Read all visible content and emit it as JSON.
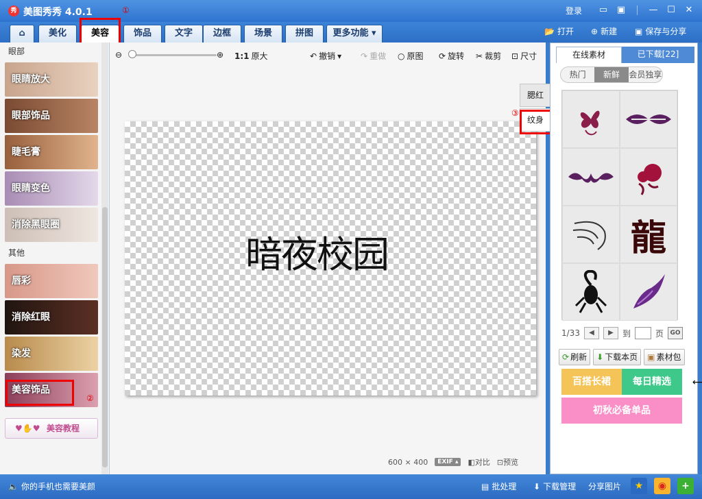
{
  "app": {
    "logo": "秀",
    "title": "美图秀秀 4.0.1",
    "mark1": "①",
    "mark2": "②",
    "mark3": "③"
  },
  "window": {
    "login": "登录"
  },
  "tabs": [
    {
      "label": "美化"
    },
    {
      "label": "美容"
    },
    {
      "label": "饰品"
    },
    {
      "label": "文字"
    },
    {
      "label": "边框"
    },
    {
      "label": "场景"
    },
    {
      "label": "拼图"
    },
    {
      "label": "更多功能"
    }
  ],
  "top_actions": {
    "open": "打开",
    "new": "新建",
    "save": "保存与分享"
  },
  "left": {
    "section_eye": "眼部",
    "section_other": "其他",
    "items": [
      {
        "label": "眼睛放大",
        "color": "#c9a58a"
      },
      {
        "label": "眼部饰品",
        "color": "#8b5a3e"
      },
      {
        "label": "睫毛膏",
        "color": "#a06a45"
      },
      {
        "label": "眼睛变色",
        "color": "#b49ab8"
      },
      {
        "label": "消除黑眼圈",
        "color": "#d8c7bc"
      },
      {
        "label": "唇彩",
        "color": "#cf9487"
      },
      {
        "label": "消除红眼",
        "color": "#2c1c18"
      },
      {
        "label": "染发",
        "color": "#c89a5a"
      },
      {
        "label": "美容饰品",
        "color": "#a3536a"
      }
    ],
    "tutorial": "美容教程"
  },
  "toolbar": {
    "ratio": "1:1",
    "original_size": "原大",
    "undo": "撤销",
    "redo": "重做",
    "original": "原图",
    "rotate": "旋转",
    "crop": "裁剪",
    "size": "尺寸"
  },
  "canvas": {
    "text": "暗夜校园",
    "width": "600",
    "times": "×",
    "height": "400",
    "exif": "EXIF",
    "compare": "对比",
    "preview": "预览"
  },
  "side_tabs": [
    {
      "label": "腮红"
    },
    {
      "label": "纹身"
    }
  ],
  "right": {
    "tab_online": "在线素材",
    "tab_downloaded": "已下载[22]",
    "subtabs": [
      {
        "label": "热门"
      },
      {
        "label": "新鲜"
      },
      {
        "label": "会员独享"
      }
    ],
    "dragon": "龍",
    "page_info": "1/33",
    "goto": "到",
    "page_unit": "页",
    "go": "GO",
    "refresh": "刷新",
    "download_page": "下载本页",
    "package": "素材包",
    "promo": [
      {
        "label": "百搭长裙"
      },
      {
        "label": "每日精选"
      },
      {
        "label": "初秋必备单品"
      }
    ],
    "arrow": "⟵"
  },
  "status": {
    "message": "你的手机也需要美颜",
    "batch": "批处理",
    "download_mgr": "下载管理",
    "share": "分享图片"
  }
}
